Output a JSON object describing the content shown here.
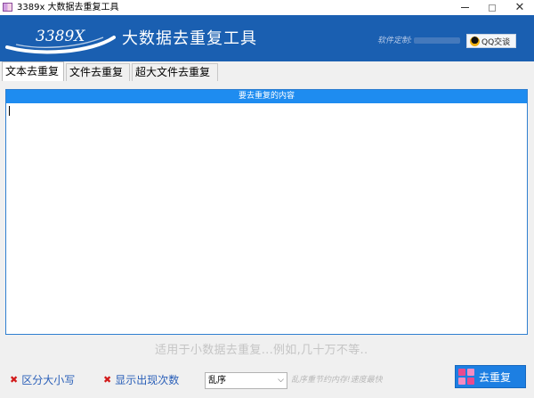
{
  "window": {
    "title": "3389x 大数据去重复工具",
    "controls": {
      "minimize": "minimize",
      "maximize": "maximize",
      "close": "✕"
    }
  },
  "banner": {
    "logo_text": "3389X",
    "title": "大数据去重复工具",
    "author_label": "软件定制:",
    "qq_button": "QQ交谈",
    "background": "#1a5fb1"
  },
  "tabs": [
    {
      "label": "文本去重复",
      "active": true
    },
    {
      "label": "文件去重复",
      "active": false
    },
    {
      "label": "超大文件去重复",
      "active": false
    }
  ],
  "content": {
    "header": "要去重复的内容",
    "value": "",
    "header_color": "#1e8cf0"
  },
  "hint": "适用于小数据去重复...例如,几十万不等..",
  "options": {
    "case_sensitive": "区分大小写",
    "show_count": "显示出现次数"
  },
  "order_select": {
    "selected": "乱序",
    "hint": "乱序重节约内存!速度最快"
  },
  "run_button": {
    "label": "去重复",
    "color": "#1d7fe2"
  }
}
